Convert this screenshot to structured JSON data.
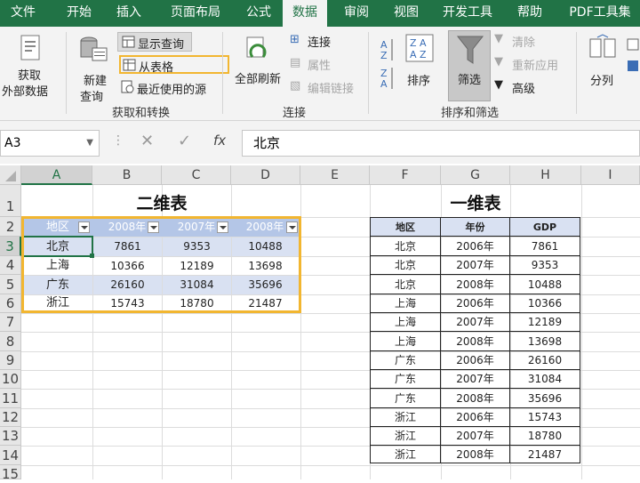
{
  "tabs": [
    "文件",
    "开始",
    "插入",
    "页面布局",
    "公式",
    "数据",
    "审阅",
    "视图",
    "开发工具",
    "帮助",
    "PDF工具集"
  ],
  "ribbon": {
    "get_data": [
      "获取",
      "外部数据"
    ],
    "new_query": [
      "新建",
      "查询"
    ],
    "show_queries": "显示查询",
    "from_table": "从表格",
    "recent_sources": "最近使用的源",
    "group_get_transform": "获取和转换",
    "refresh_all": "全部刷新",
    "connections": "连接",
    "properties": "属性",
    "edit_links": "编辑链接",
    "group_connections": "连接",
    "sort": "排序",
    "filter": "筛选",
    "clear": "清除",
    "reapply": "重新应用",
    "advanced": "高级",
    "group_sort_filter": "排序和筛选",
    "split": "分列"
  },
  "formula_bar": {
    "name_box": "A3",
    "fx": "fx",
    "content": "北京"
  },
  "columns": [
    "A",
    "B",
    "C",
    "D",
    "E",
    "F",
    "G",
    "H",
    "I"
  ],
  "rows": [
    "1",
    "2",
    "3",
    "4",
    "5",
    "6",
    "7",
    "8",
    "9",
    "10",
    "11",
    "12",
    "13",
    "14",
    "15"
  ],
  "table2d": {
    "title": "二维表",
    "headers": [
      "地区",
      "2008年",
      "2007年",
      "2008年"
    ],
    "rows": [
      [
        "北京",
        "7861",
        "9353",
        "10488"
      ],
      [
        "上海",
        "10366",
        "12189",
        "13698"
      ],
      [
        "广东",
        "26160",
        "31084",
        "35696"
      ],
      [
        "浙江",
        "15743",
        "18780",
        "21487"
      ]
    ]
  },
  "table1d": {
    "title": "一维表",
    "headers": [
      "地区",
      "年份",
      "GDP"
    ],
    "rows": [
      [
        "北京",
        "2006年",
        "7861"
      ],
      [
        "北京",
        "2007年",
        "9353"
      ],
      [
        "北京",
        "2008年",
        "10488"
      ],
      [
        "上海",
        "2006年",
        "10366"
      ],
      [
        "上海",
        "2007年",
        "12189"
      ],
      [
        "上海",
        "2008年",
        "13698"
      ],
      [
        "广东",
        "2006年",
        "26160"
      ],
      [
        "广东",
        "2007年",
        "31084"
      ],
      [
        "广东",
        "2008年",
        "35696"
      ],
      [
        "浙江",
        "2006年",
        "15743"
      ],
      [
        "浙江",
        "2007年",
        "18780"
      ],
      [
        "浙江",
        "2008年",
        "21487"
      ]
    ]
  },
  "colors": {
    "accent": "#217346",
    "highlight": "#f2b630",
    "header_fill": "#b4c6e7",
    "band_fill": "#d9e1f2"
  }
}
